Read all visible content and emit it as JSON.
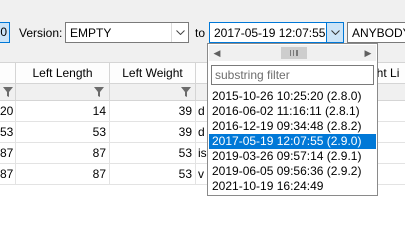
{
  "toolbar": {
    "prev_label": "0",
    "version_label": "Version:",
    "version_value": "EMPTY",
    "to_label": "to",
    "to_value": "2017-05-19 12:07:55",
    "user_value": "ANYBODY"
  },
  "grid": {
    "headers": [
      "",
      "Left Length",
      "Left Weight",
      "",
      "ght Li"
    ],
    "rows": [
      [
        "20",
        "14",
        "39",
        "87",
        "d"
      ],
      [
        "53",
        "53",
        "39",
        "87",
        "d"
      ],
      [
        "87",
        "87",
        "53",
        "110",
        "is"
      ],
      [
        "87",
        "87",
        "53",
        "110",
        "v"
      ]
    ]
  },
  "dropdown": {
    "filter_placeholder": "substring filter",
    "options": [
      "2015-10-26 10:25:20 (2.8.0)",
      "2016-06-02 11:16:11 (2.8.1)",
      "2016-12-19 09:34:48 (2.8.2)",
      "2017-05-19 12:07:55 (2.9.0)",
      "2019-03-26 09:57:14 (2.9.1)",
      "2019-06-05 09:56:36 (2.9.2)",
      "2021-10-19 16:24:49"
    ],
    "selected_index": 3
  },
  "icons": {
    "funnel": "funnel-icon",
    "dropdown": "chevron-down-icon",
    "scroll_left": "scroll-left-icon",
    "scroll_right": "scroll-right-icon"
  },
  "colors": {
    "accent": "#0078d7",
    "focus_fill": "#cce4f7"
  }
}
